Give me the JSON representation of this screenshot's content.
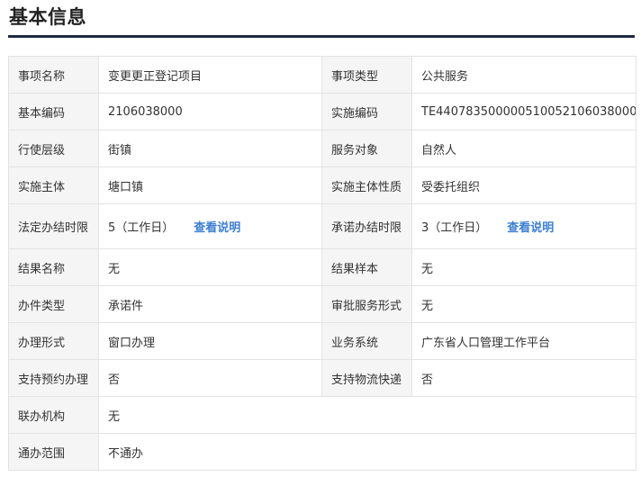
{
  "page": {
    "title": "基本信息"
  },
  "colors": {
    "accent_rule": "#1f2a44",
    "label_bg": "#f5f5f5",
    "link": "#3b7fd6"
  },
  "rows": [
    {
      "l1": "事项名称",
      "v1": "变更更正登记项目",
      "l2": "事项类型",
      "v2": "公共服务"
    },
    {
      "l1": "基本编码",
      "v1": "2106038000",
      "l2": "实施编码",
      "v2": "TE440783500000510052106038000"
    },
    {
      "l1": "行使层级",
      "v1": "街镇",
      "l2": "服务对象",
      "v2": "自然人"
    },
    {
      "l1": "实施主体",
      "v1": "塘口镇",
      "l2": "实施主体性质",
      "v2": "受委托组织"
    },
    {
      "l1": "法定办结时限",
      "v1": "5（工作日）",
      "link1": "查看说明",
      "l2": "承诺办结时限",
      "v2": "3（工作日）",
      "link2": "查看说明"
    },
    {
      "l1": "结果名称",
      "v1": "无",
      "l2": "结果样本",
      "v2": "无"
    },
    {
      "l1": "办件类型",
      "v1": "承诺件",
      "l2": "审批服务形式",
      "v2": "无"
    },
    {
      "l1": "办理形式",
      "v1": "窗口办理",
      "l2": "业务系统",
      "v2": "广东省人口管理工作平台"
    },
    {
      "l1": "支持预约办理",
      "v1": "否",
      "l2": "支持物流快递",
      "v2": "否"
    },
    {
      "l1": "联办机构",
      "v1": "无"
    },
    {
      "l1": "通办范围",
      "v1": "不通办"
    }
  ]
}
